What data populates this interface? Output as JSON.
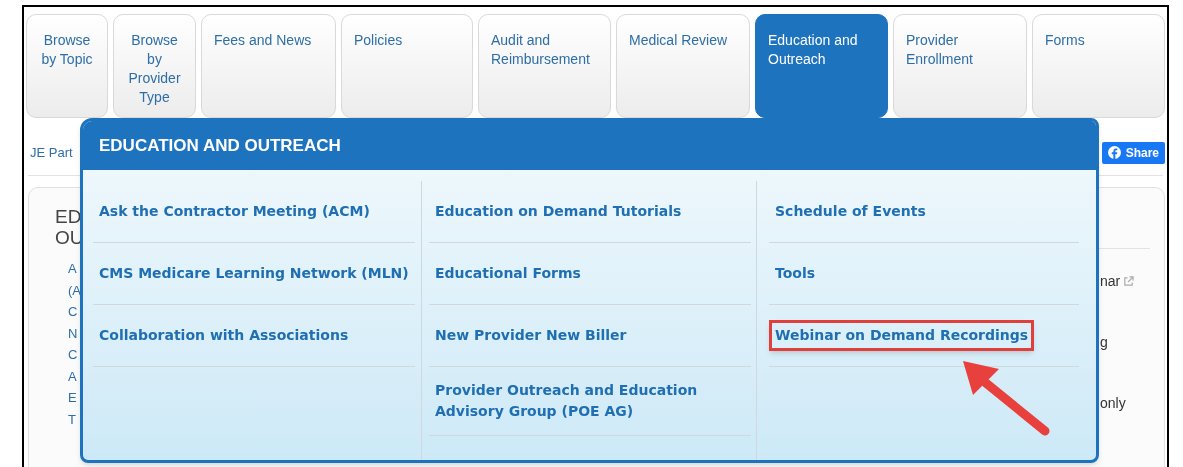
{
  "tabs": [
    {
      "label": "Browse by Topic",
      "selected": false
    },
    {
      "label": "Browse by Provider Type",
      "selected": false
    },
    {
      "label": "Fees and News",
      "selected": false
    },
    {
      "label": "Policies",
      "selected": false
    },
    {
      "label": "Audit and Reimbursement",
      "selected": false
    },
    {
      "label": "Medical Review",
      "selected": false
    },
    {
      "label": "Education and Outreach",
      "selected": true
    },
    {
      "label": "Provider Enrollment",
      "selected": false
    },
    {
      "label": "Forms",
      "selected": false
    }
  ],
  "breadcrumb": "JE Part",
  "share_button": "Share",
  "page_heading": [
    "ED",
    "OU"
  ],
  "page_links": [
    "A",
    "(A",
    "C",
    "N",
    "C",
    "A",
    "E",
    "T"
  ],
  "right_fragments": [
    {
      "text": "nar",
      "external": true
    },
    {
      "text": "g",
      "external": false
    },
    {
      "text": "only",
      "external": false
    }
  ],
  "mega_menu": {
    "title": "EDUCATION AND OUTREACH",
    "columns": [
      [
        {
          "label": "Ask the Contractor Meeting (ACM)",
          "highlighted": false
        },
        {
          "label": "CMS Medicare Learning Network (MLN)",
          "highlighted": false
        },
        {
          "label": "Collaboration with Associations",
          "highlighted": false
        }
      ],
      [
        {
          "label": "Education on Demand Tutorials",
          "highlighted": false
        },
        {
          "label": "Educational Forms",
          "highlighted": false
        },
        {
          "label": "New Provider New Biller",
          "highlighted": false
        },
        {
          "label": "Provider Outreach and Education Advisory Group (POE AG)",
          "highlighted": false
        }
      ],
      [
        {
          "label": "Schedule of Events",
          "highlighted": false
        },
        {
          "label": "Tools",
          "highlighted": false
        },
        {
          "label": "Webinar on Demand Recordings",
          "highlighted": true
        }
      ]
    ]
  }
}
